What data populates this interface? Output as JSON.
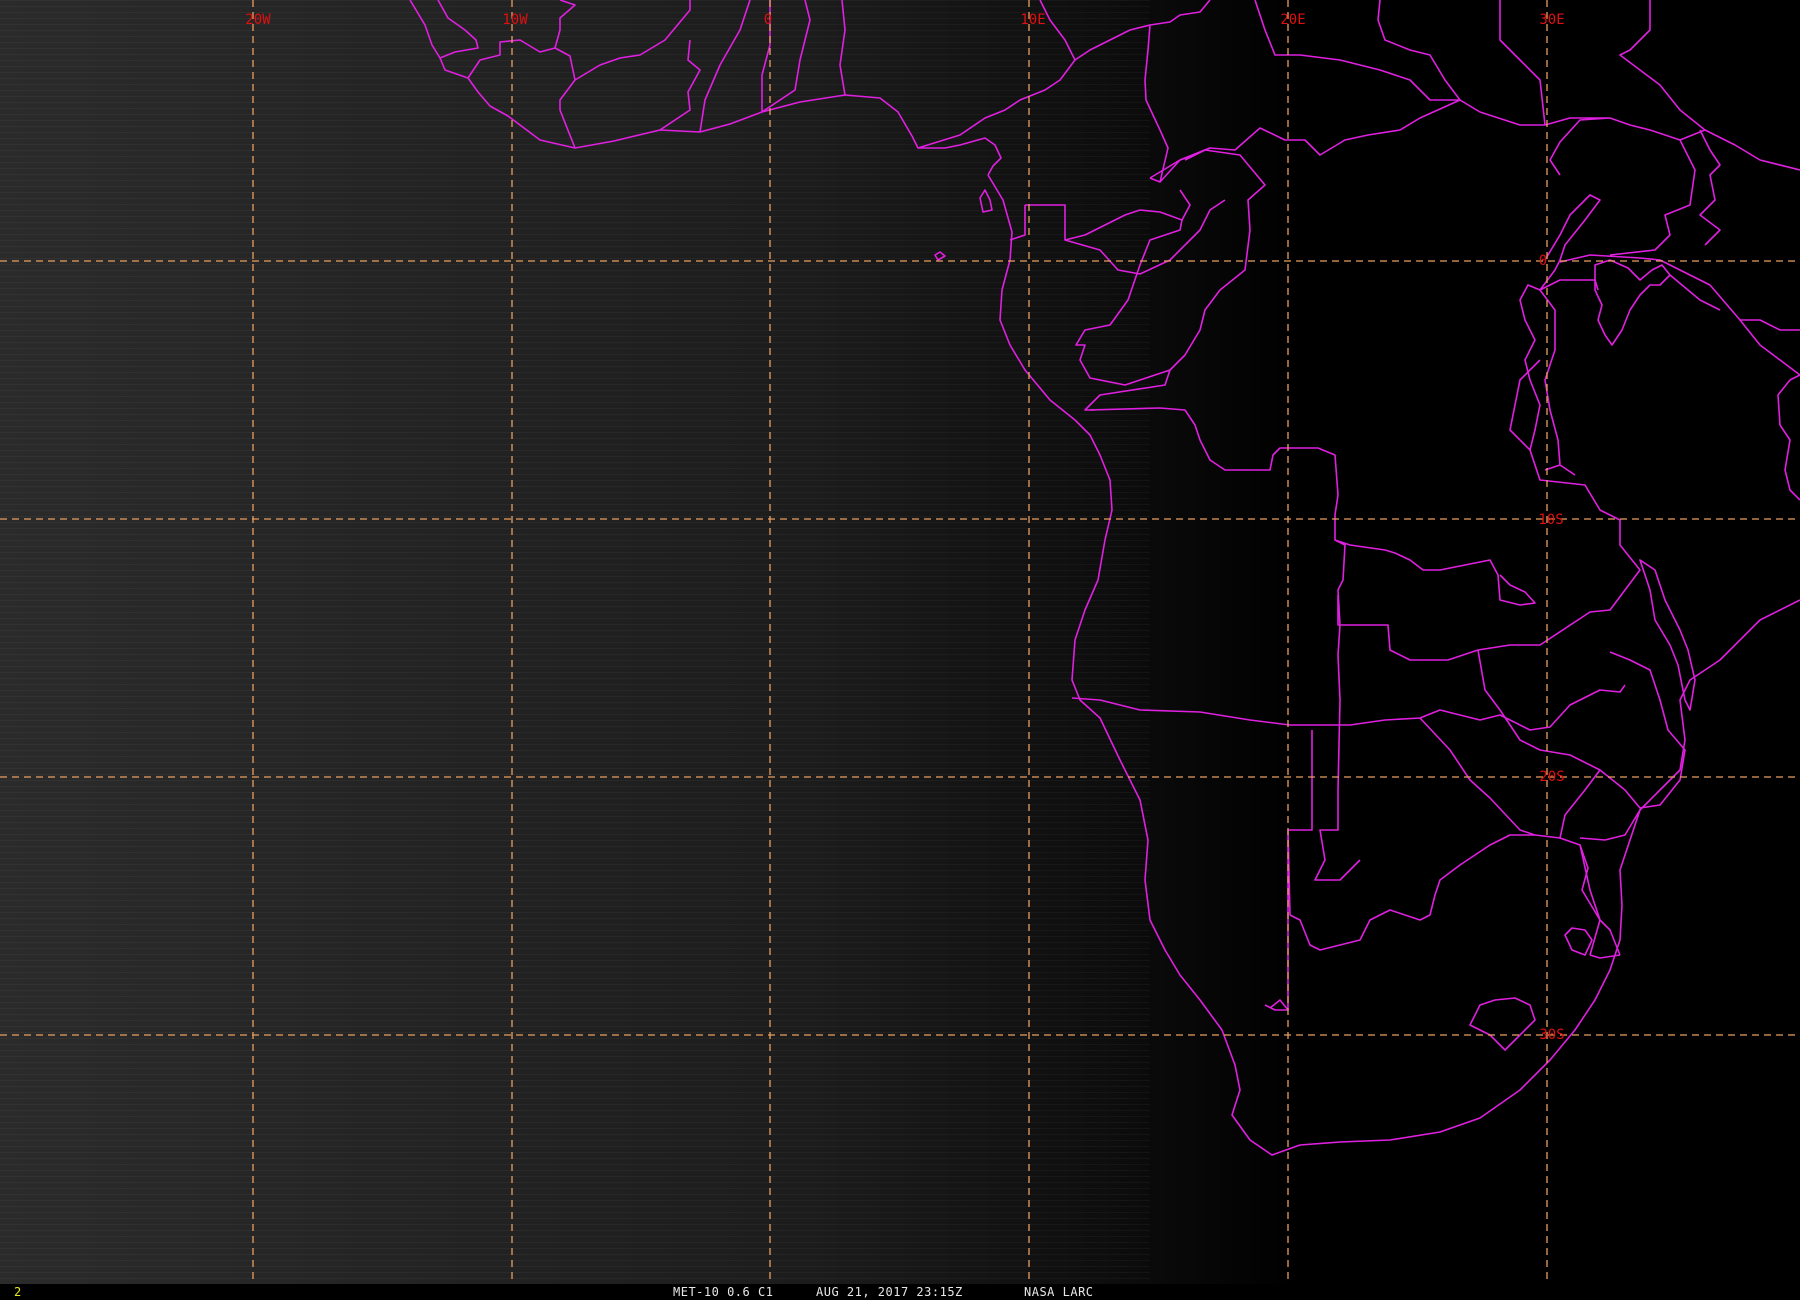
{
  "map": {
    "satellite_product": "MET-10 0.6 C1",
    "timestamp": "AUG 21, 2017 23:15Z",
    "source": "NASA LARC",
    "frame_number": "2",
    "longitude_labels": [
      "20W",
      "10W",
      "0",
      "10E",
      "20E",
      "30E"
    ],
    "latitude_labels": [
      "0",
      "10S",
      "20S",
      "30S"
    ],
    "colors": {
      "background": "#000000",
      "ocean_glow": "#2a2a2a",
      "borders": "#e020e0",
      "graticule": "#e8a060",
      "grid_labels": "#e01010",
      "caption": "#e8e8e8",
      "frame_number": "#e8e820"
    },
    "overlay": {
      "graticule": "dashed",
      "political_boundaries": true
    }
  }
}
